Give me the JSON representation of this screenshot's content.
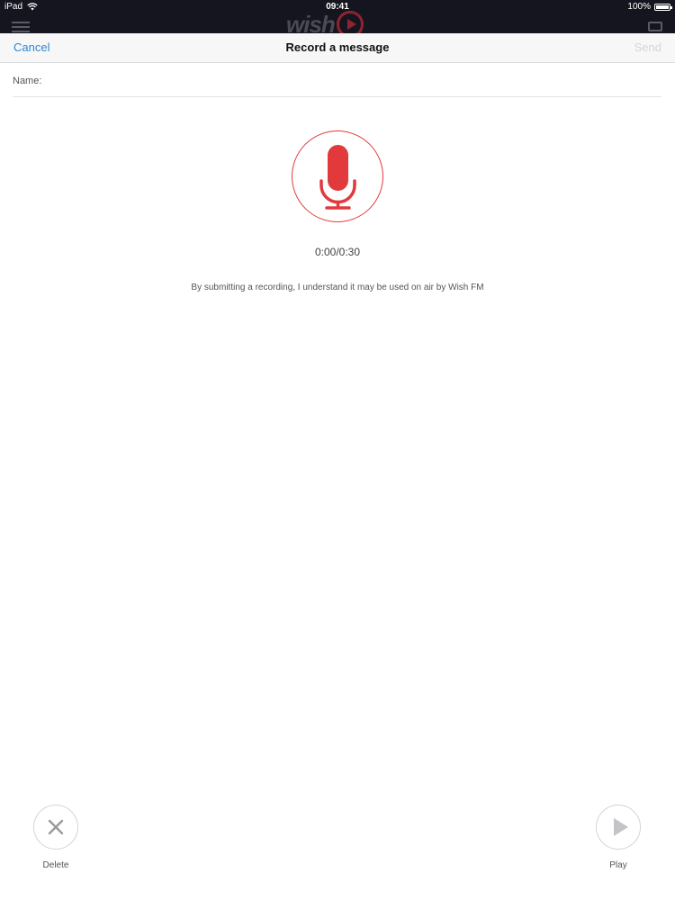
{
  "status_bar": {
    "device": "iPad",
    "time": "09:41",
    "battery": "100%"
  },
  "app": {
    "logo_text": "wish"
  },
  "nav": {
    "cancel_label": "Cancel",
    "title": "Record a message",
    "send_label": "Send"
  },
  "form": {
    "name_label": "Name:",
    "name_value": ""
  },
  "recorder": {
    "timer": "0:00/0:30",
    "disclaimer": "By submitting a recording, I understand it may be used on air by Wish FM"
  },
  "controls": {
    "delete_label": "Delete",
    "play_label": "Play"
  },
  "colors": {
    "accent_red": "#e2393c",
    "link_blue": "#2f86cf",
    "disabled_gray": "#d5d5d8",
    "chrome_dark": "#15151f"
  },
  "icons": {
    "record": "microphone-icon",
    "delete": "close-icon",
    "play": "play-icon",
    "menu": "hamburger-menu-icon",
    "chat": "chat-bubble-icon",
    "wifi": "wifi-icon",
    "battery": "battery-icon"
  }
}
